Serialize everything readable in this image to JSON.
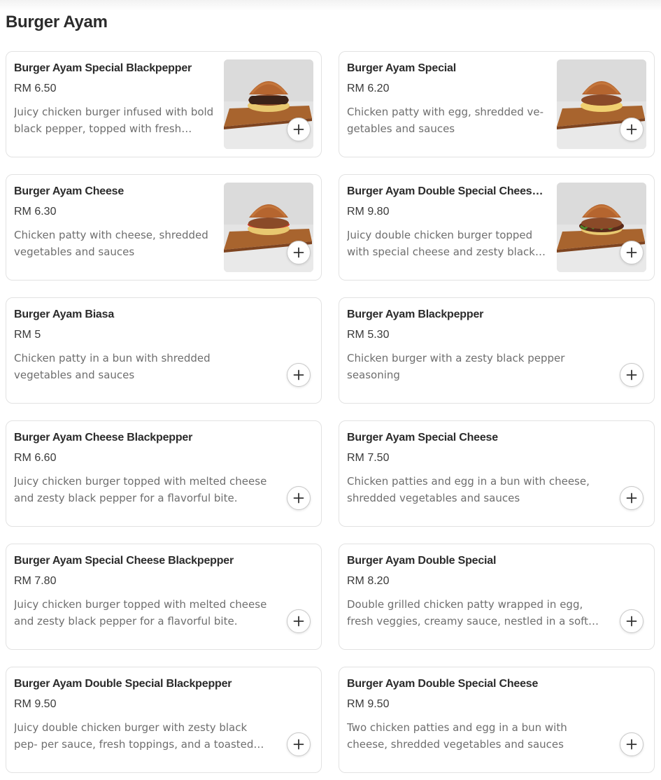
{
  "section": {
    "title": "Burger Ayam"
  },
  "items": [
    {
      "name": "Burger Ayam Special Blackpepper",
      "price": "RM 6.50",
      "description": "Juicy chicken burger infused with bold black pepper, topped with fresh veg-…",
      "image": "burger-photo"
    },
    {
      "name": "Burger Ayam Special",
      "price": "RM 6.20",
      "description": "Chicken patty with egg, shredded ve- getables and sauces",
      "image": "burger-photo"
    },
    {
      "name": "Burger Ayam Cheese",
      "price": "RM 6.30",
      "description": "Chicken patty with cheese, shredded vegetables and sauces",
      "image": "burger-photo"
    },
    {
      "name": "Burger Ayam Double Special Chees…",
      "price": "RM 9.80",
      "description": "Juicy double chicken burger topped with special cheese and zesty black…",
      "image": "burger-photo"
    },
    {
      "name": "Burger Ayam Biasa",
      "price": "RM 5",
      "description": "Chicken patty in a bun with shredded vegetables and sauces"
    },
    {
      "name": "Burger Ayam Blackpepper",
      "price": "RM 5.30",
      "description": "Chicken burger with a zesty black pepper seasoning"
    },
    {
      "name": "Burger Ayam Cheese Blackpepper",
      "price": "RM 6.60",
      "description": "Juicy chicken burger topped with melted cheese and zesty black pepper for a flavorful bite."
    },
    {
      "name": "Burger Ayam Special Cheese",
      "price": "RM 7.50",
      "description": "Chicken patties and egg in a bun with cheese, shredded vegetables and sauces"
    },
    {
      "name": "Burger Ayam Special Cheese Blackpepper",
      "price": "RM 7.80",
      "description": "Juicy chicken burger topped with melted cheese and zesty black pepper for a flavorful bite."
    },
    {
      "name": "Burger Ayam Double Special",
      "price": "RM 8.20",
      "description": "Double grilled chicken patty wrapped in egg, fresh veggies, creamy sauce, nestled in a soft bun"
    },
    {
      "name": "Burger Ayam Double Special Blackpepper",
      "price": "RM 9.50",
      "description": "Juicy double chicken burger with zesty black pep- per sauce, fresh toppings, and a toasted bun."
    },
    {
      "name": "Burger Ayam Double Special Cheese",
      "price": "RM 9.50",
      "description": "Two chicken patties and egg in a bun with cheese, shredded vegetables and sauces"
    }
  ],
  "icons": {
    "add": "plus-icon"
  },
  "colors": {
    "card_border": "#e2e2e2",
    "text": "#2b2b2b",
    "muted": "#6e6e6e"
  }
}
